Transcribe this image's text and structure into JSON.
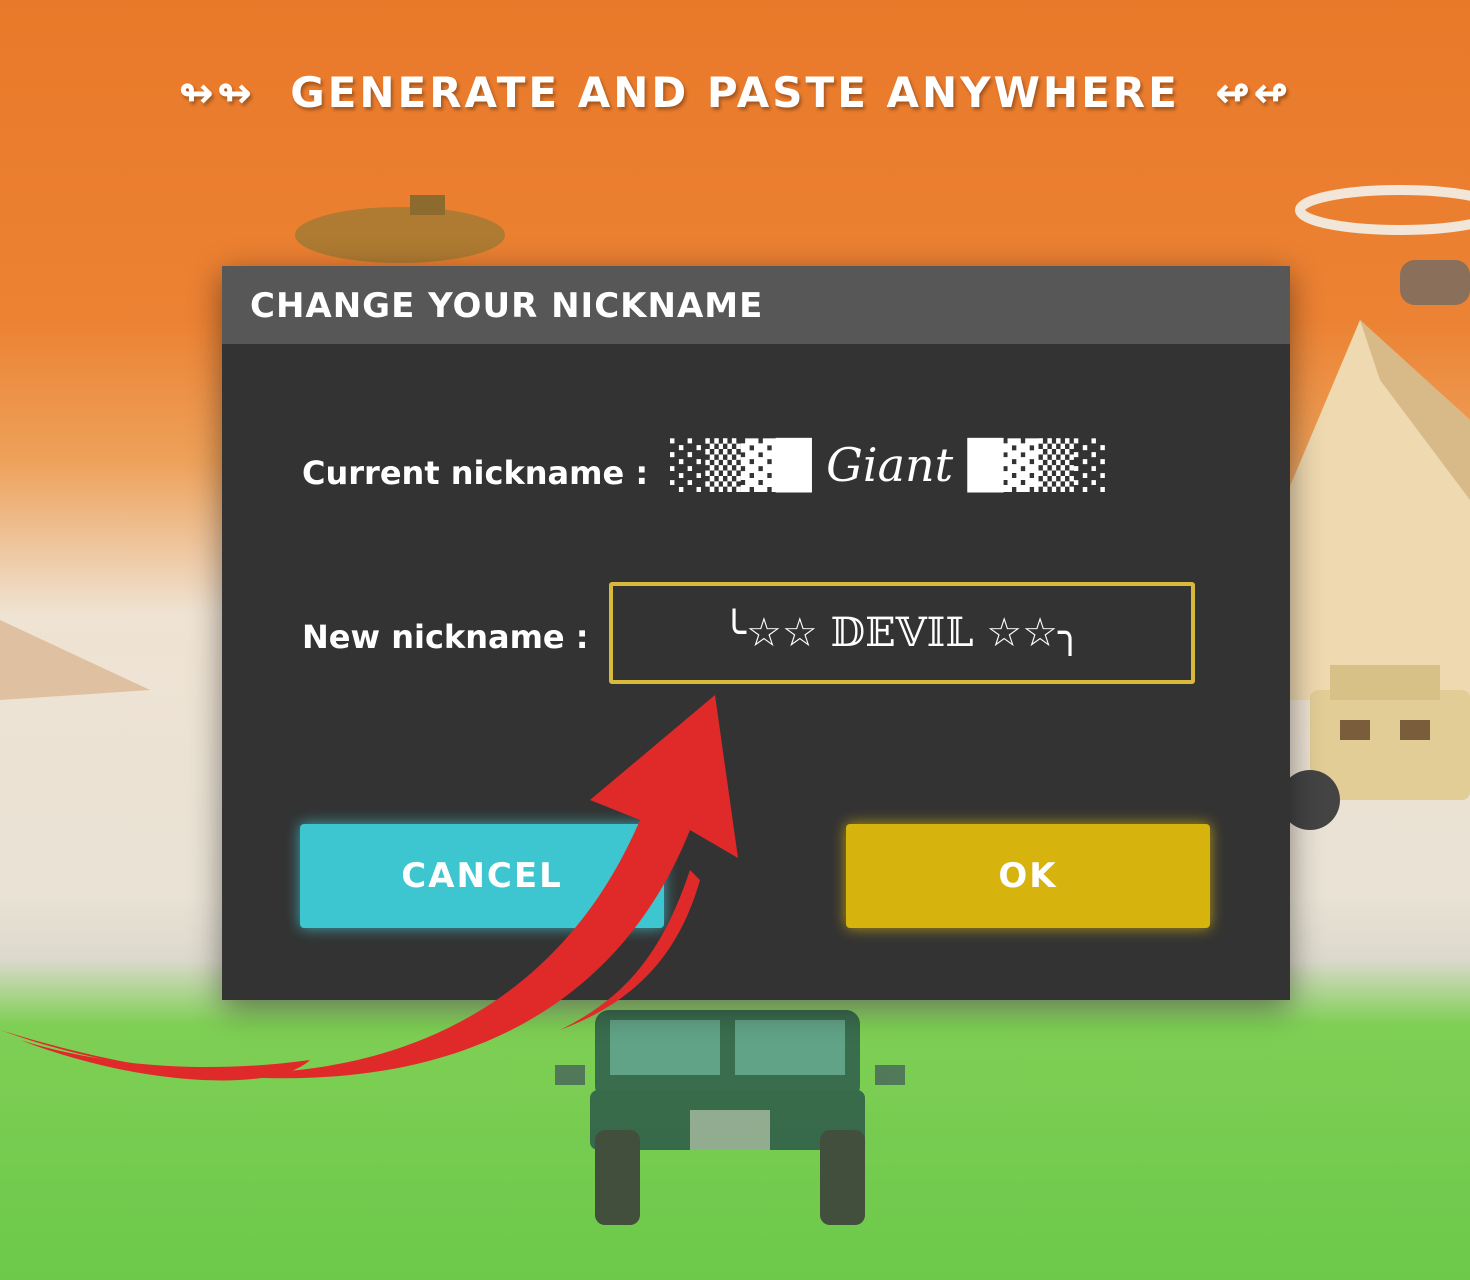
{
  "banner": {
    "prefix": "↬↬",
    "text": "GENERATE AND PASTE ANYWHERE",
    "suffix": "↫↫"
  },
  "dialog": {
    "title": "CHANGE YOUR NICKNAME",
    "current_label": "Current nickname :",
    "current_prefix": "░▒▓█",
    "current_name": "Giant",
    "current_suffix": "█▓▒░",
    "new_label": "New nickname :",
    "new_value": "╰☆☆ 𝔻𝔼𝕍𝕀𝕃 ☆☆╮",
    "cancel_label": "CANCEL",
    "ok_label": "OK"
  },
  "colors": {
    "accent_cancel": "#3ec6d0",
    "accent_ok": "#d7b30e",
    "input_border": "#d9b93a",
    "arrow": "#e02a2a"
  }
}
